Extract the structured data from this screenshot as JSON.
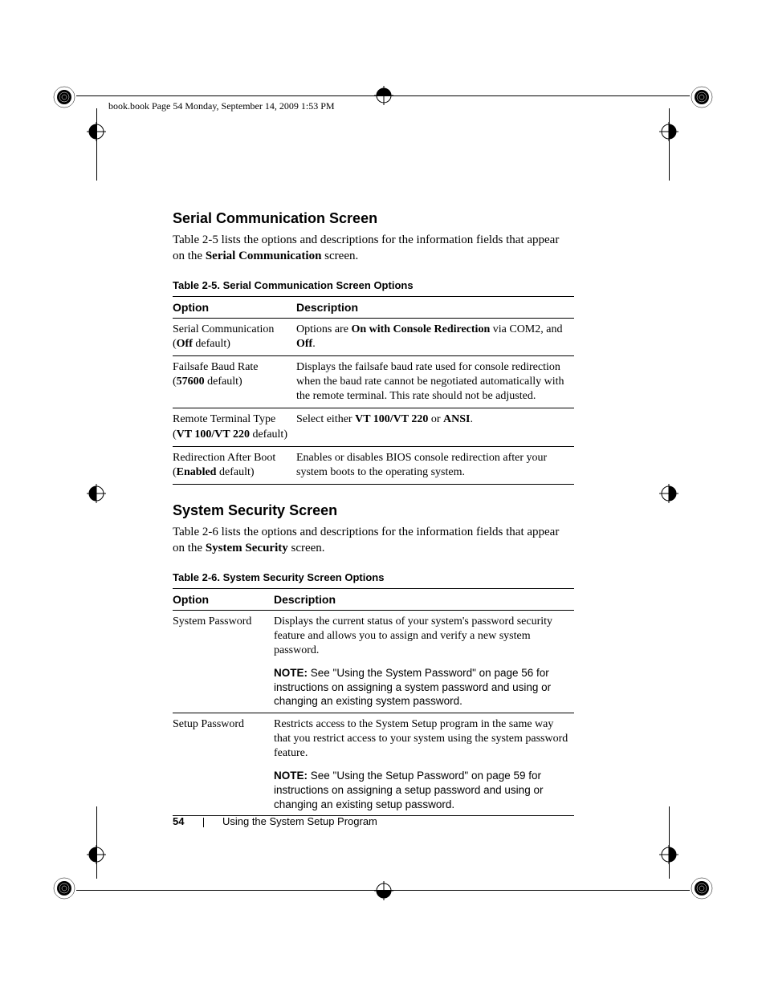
{
  "header_line": "book.book  Page 54  Monday, September 14, 2009  1:53 PM",
  "section1": {
    "heading": "Serial Communication Screen",
    "intro_pre": "Table 2-5 lists the options and descriptions for the information fields that appear on the ",
    "intro_bold": "Serial Communication",
    "intro_post": " screen.",
    "table_caption": "Table 2-5.    Serial Communication Screen Options",
    "th_option": "Option",
    "th_desc": "Description",
    "rows": [
      {
        "opt_plain": "Serial Communication",
        "opt_line2_pre": "(",
        "opt_line2_bold": "Off",
        "opt_line2_post": " default)",
        "desc_pre": "Options are ",
        "desc_bold": "On with Console Redirection",
        "desc_mid": " via COM2, and ",
        "desc_bold2": "Off",
        "desc_post": "."
      },
      {
        "opt_plain": "Failsafe Baud Rate",
        "opt_line2_pre": "(",
        "opt_line2_bold": "57600",
        "opt_line2_post": " default)",
        "desc": "Displays the failsafe baud rate used for console redirection when the baud rate cannot be negotiated automatically with the remote terminal. This rate should not be adjusted."
      },
      {
        "opt_plain": "Remote Terminal Type",
        "opt_line2_pre": "(",
        "opt_line2_bold": "VT 100/VT 220",
        "opt_line2_post": " default)",
        "desc_pre": "Select either ",
        "desc_bold": "VT 100/VT 220",
        "desc_mid": " or ",
        "desc_bold2": "ANSI",
        "desc_post": "."
      },
      {
        "opt_plain": "Redirection After Boot",
        "opt_line2_pre": "(",
        "opt_line2_bold": "Enabled",
        "opt_line2_post": " default)",
        "desc": "Enables or disables BIOS console redirection after your system boots to the operating system."
      }
    ]
  },
  "section2": {
    "heading": "System Security Screen",
    "intro_pre": "Table 2-6 lists the options and descriptions for the information fields that appear on the ",
    "intro_bold": "System Security",
    "intro_post": " screen.",
    "table_caption": "Table 2-6.    System Security Screen Options",
    "th_option": "Option",
    "th_desc": "Description",
    "rows": [
      {
        "opt": "System Password",
        "desc": "Displays the current status of your system's password security feature and allows you to assign and verify a new system password.",
        "note_label": "NOTE:",
        "note": " See \"Using the System Password\" on page 56 for instructions on assigning a system password and using or changing an existing system password."
      },
      {
        "opt": "Setup Password",
        "desc": "Restricts access to the System Setup program in the same way that you restrict access to your system using the system password feature.",
        "note_label": "NOTE:",
        "note": " See \"Using the Setup Password\" on page 59 for instructions on assigning a setup password and using or changing an existing setup password."
      }
    ]
  },
  "footer": {
    "page_num": "54",
    "title": "Using the System Setup Program"
  }
}
